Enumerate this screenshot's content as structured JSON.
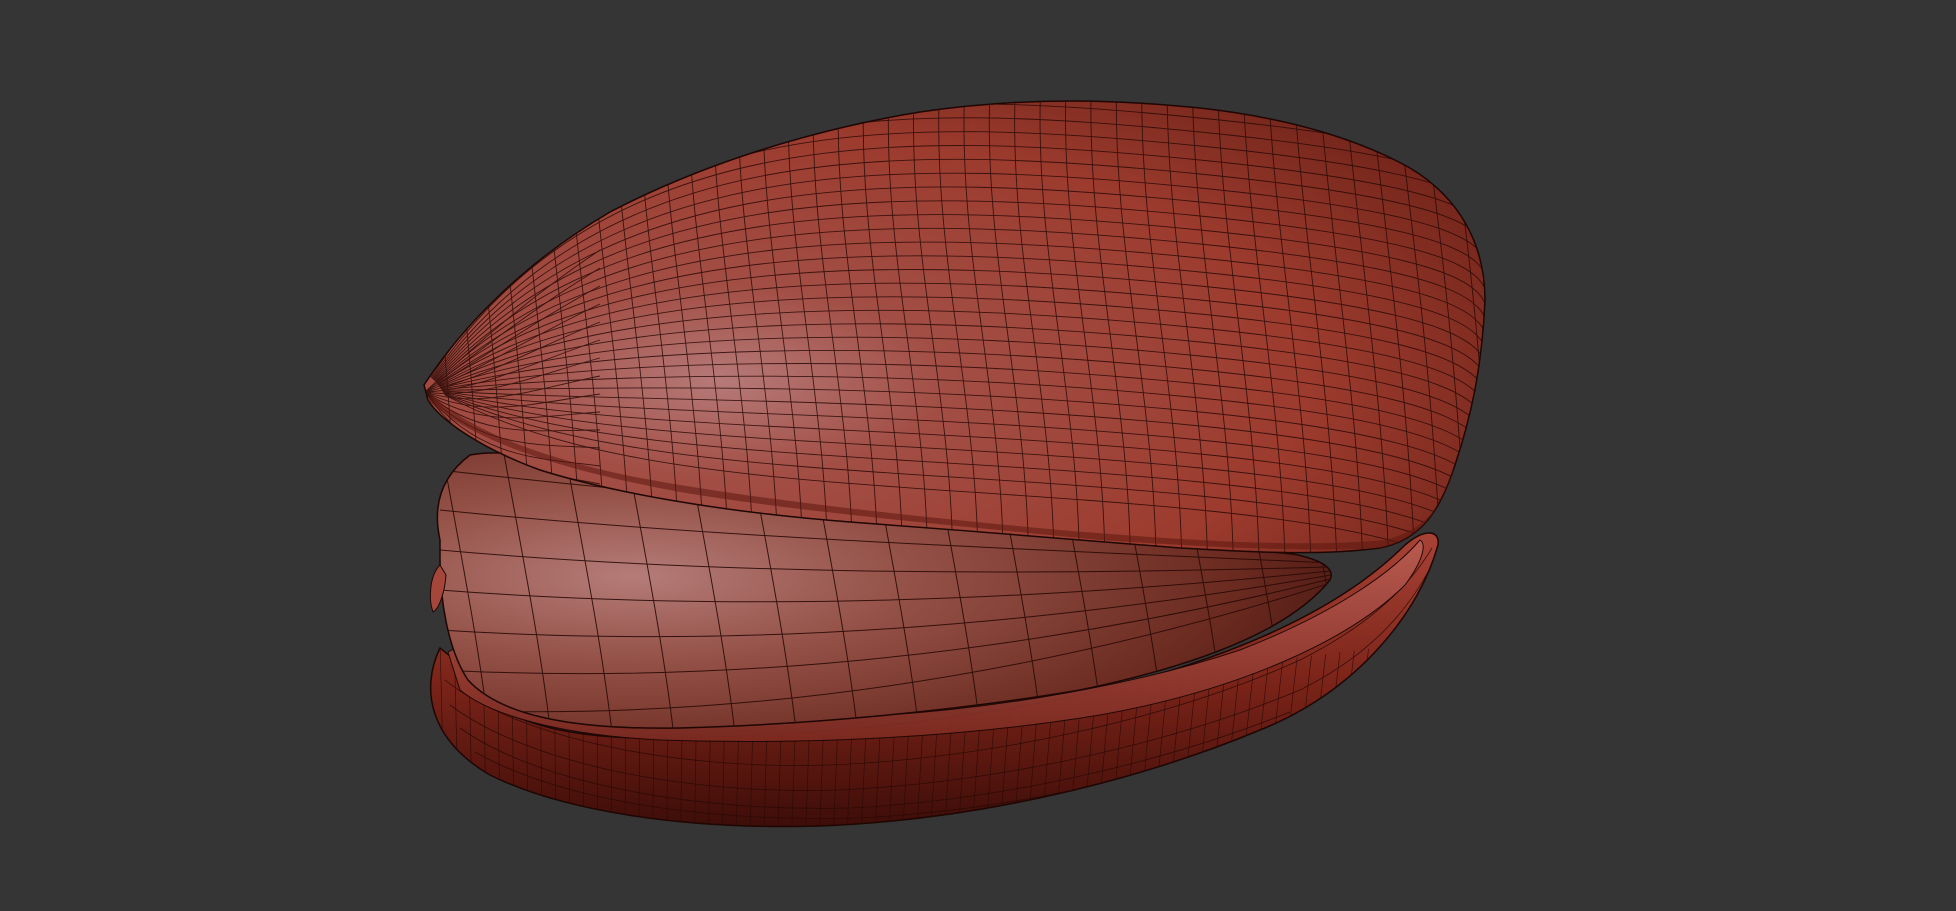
{
  "viewport": {
    "background_color": "#353535",
    "mesh_color": "#b24a3e",
    "wire_color": "#2a0c08",
    "highlight_color": "#c98a86",
    "shadow_color": "#3a0d08"
  },
  "model": {
    "name": "",
    "display_mode": "polyframe"
  }
}
